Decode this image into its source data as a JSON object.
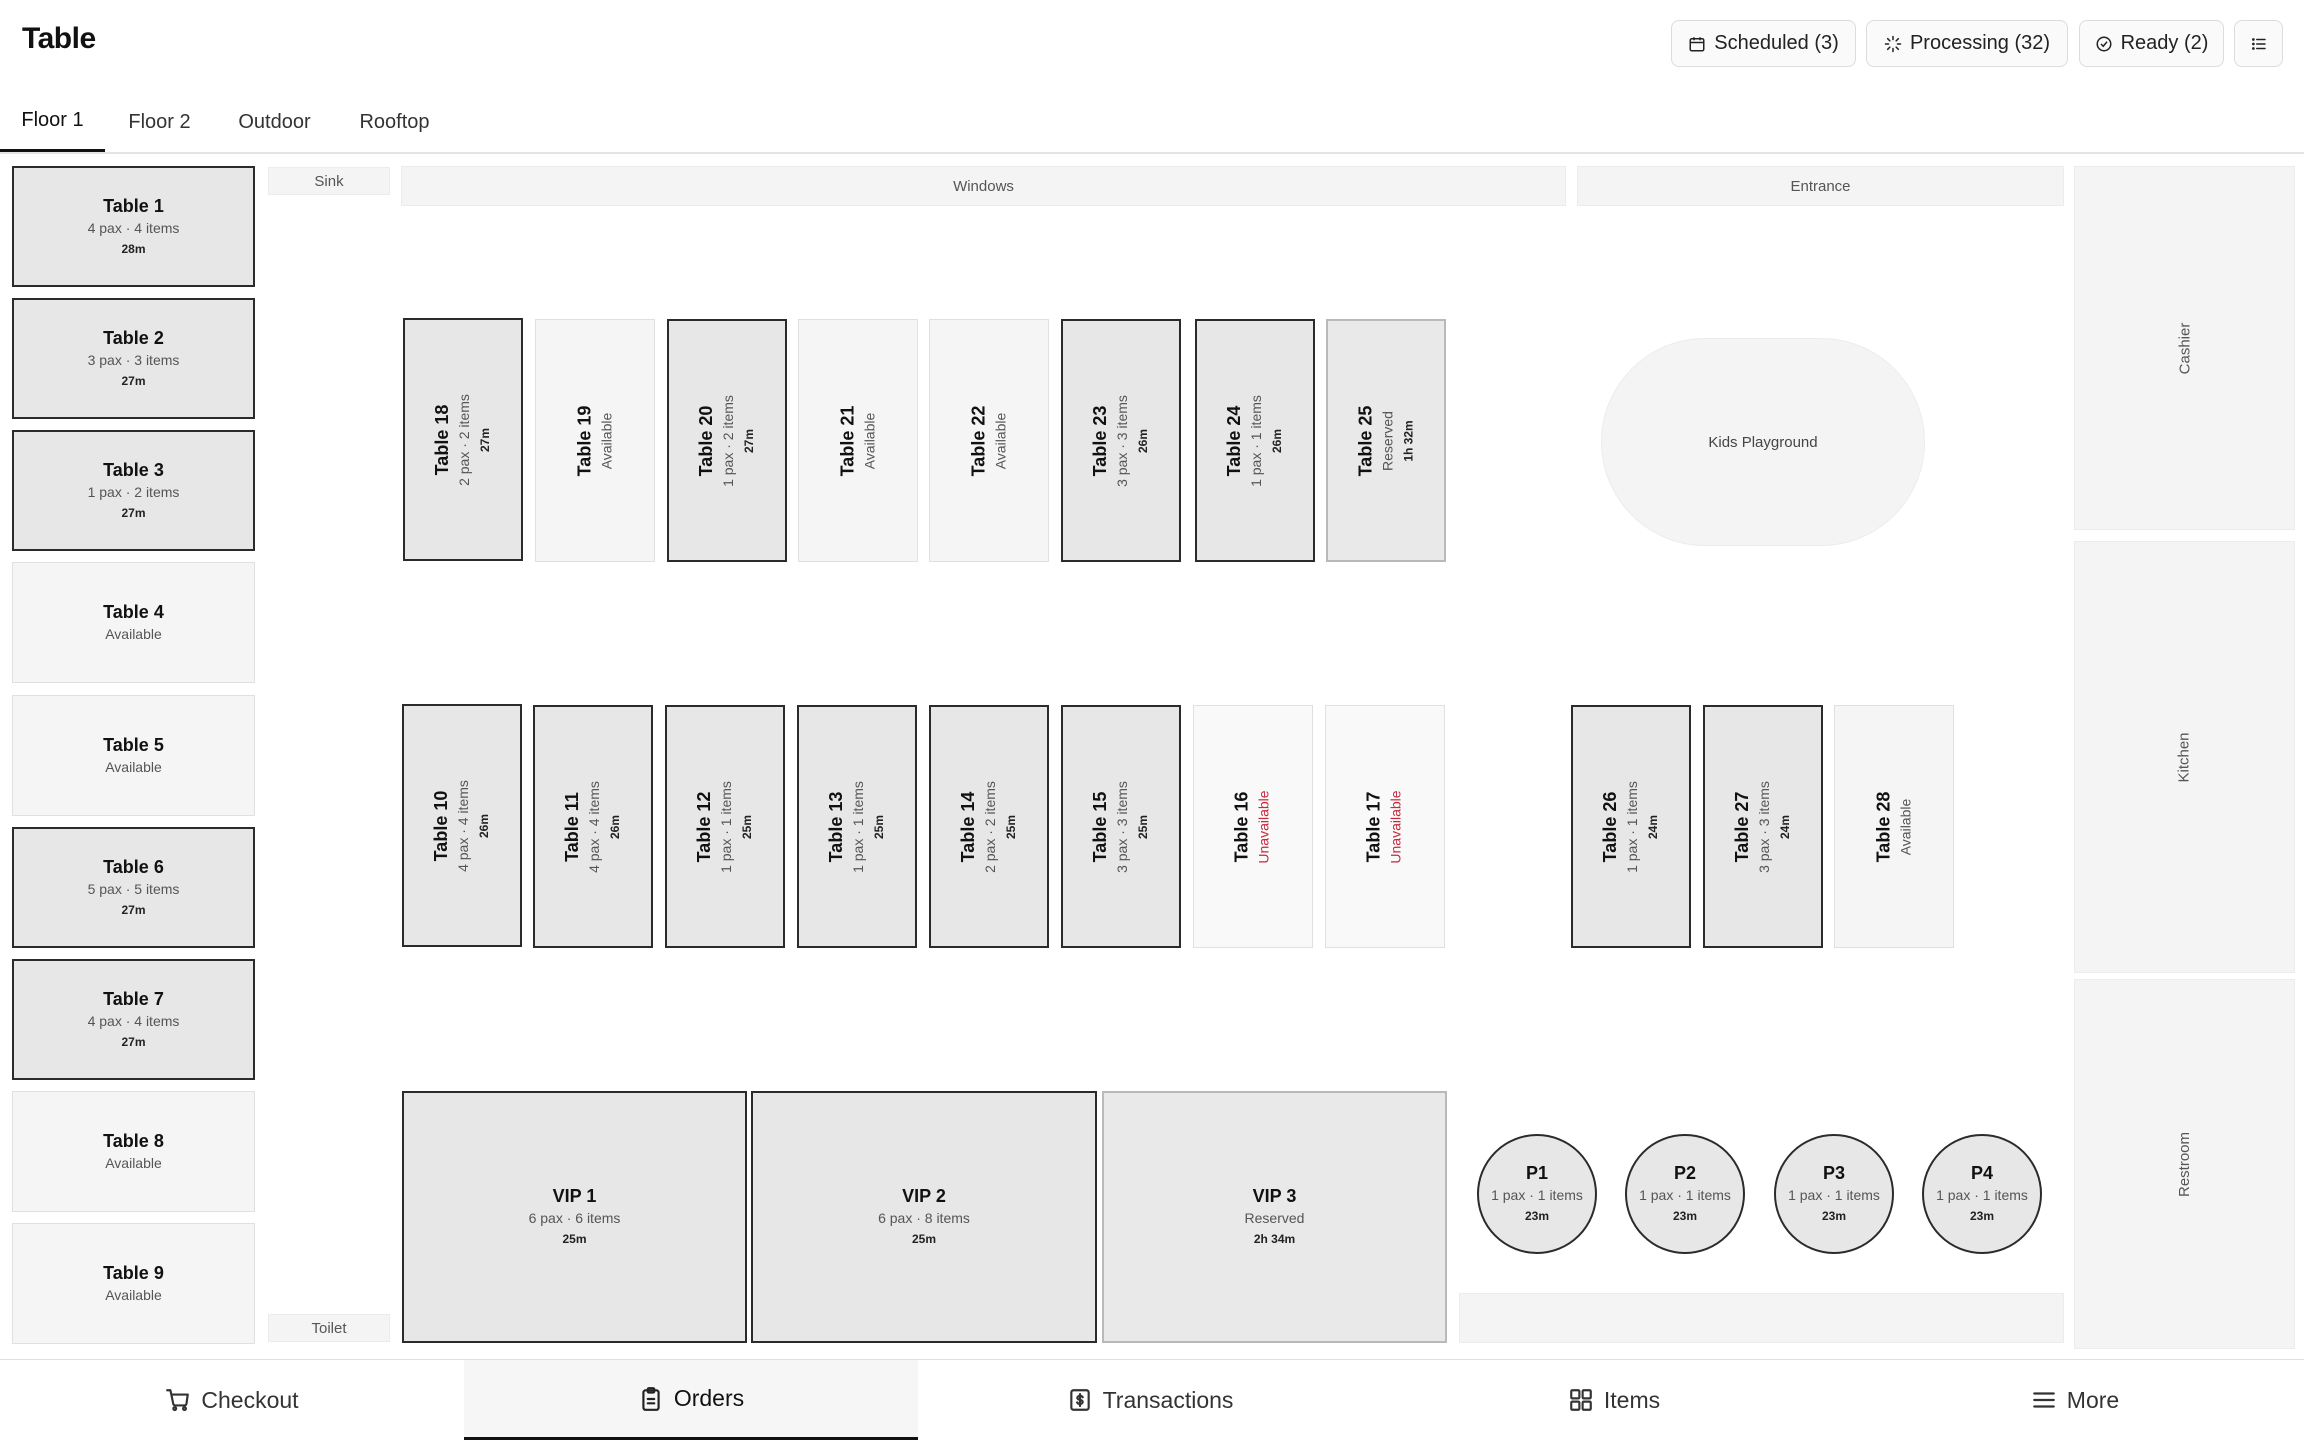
{
  "header": {
    "title": "Table",
    "scheduled_label": "Scheduled (3)",
    "processing_label": "Processing (32)",
    "ready_label": "Ready (2)"
  },
  "tabs": [
    "Floor 1",
    "Floor 2",
    "Outdoor",
    "Rooftop"
  ],
  "active_tab": "Floor 1",
  "zones": {
    "sink": "Sink",
    "toilet": "Toilet",
    "windows": "Windows",
    "entrance": "Entrance",
    "kids_playground": "Kids Playground",
    "cashier": "Cashier",
    "kitchen": "Kitchen",
    "restroom": "Restroom"
  },
  "tables": {
    "t1": {
      "name": "Table 1",
      "info": "4 pax · 4 items",
      "time": "28m"
    },
    "t2": {
      "name": "Table 2",
      "info": "3 pax · 3 items",
      "time": "27m"
    },
    "t3": {
      "name": "Table 3",
      "info": "1 pax · 2 items",
      "time": "27m"
    },
    "t4": {
      "name": "Table 4",
      "info": "Available"
    },
    "t5": {
      "name": "Table 5",
      "info": "Available"
    },
    "t6": {
      "name": "Table 6",
      "info": "5 pax · 5 items",
      "time": "27m"
    },
    "t7": {
      "name": "Table 7",
      "info": "4 pax · 4 items",
      "time": "27m"
    },
    "t8": {
      "name": "Table 8",
      "info": "Available"
    },
    "t9": {
      "name": "Table 9",
      "info": "Available"
    },
    "t10": {
      "name": "Table 10",
      "info": "4 pax · 4 items",
      "time": "26m"
    },
    "t11": {
      "name": "Table 11",
      "info": "4 pax · 4 items",
      "time": "26m"
    },
    "t12": {
      "name": "Table 12",
      "info": "1 pax · 1 items",
      "time": "25m"
    },
    "t13": {
      "name": "Table 13",
      "info": "1 pax · 1 items",
      "time": "25m"
    },
    "t14": {
      "name": "Table 14",
      "info": "2 pax · 2 items",
      "time": "25m"
    },
    "t15": {
      "name": "Table 15",
      "info": "3 pax · 3 items",
      "time": "25m"
    },
    "t16": {
      "name": "Table 16",
      "info": "Unavailable"
    },
    "t17": {
      "name": "Table 17",
      "info": "Unavailable"
    },
    "t18": {
      "name": "Table 18",
      "info": "2 pax · 2 items",
      "time": "27m"
    },
    "t19": {
      "name": "Table 19",
      "info": "Available"
    },
    "t20": {
      "name": "Table 20",
      "info": "1 pax · 2 items",
      "time": "27m"
    },
    "t21": {
      "name": "Table 21",
      "info": "Available"
    },
    "t22": {
      "name": "Table 22",
      "info": "Available"
    },
    "t23": {
      "name": "Table 23",
      "info": "3 pax · 3 items",
      "time": "26m"
    },
    "t24": {
      "name": "Table 24",
      "info": "1 pax · 1 items",
      "time": "26m"
    },
    "t25": {
      "name": "Table 25",
      "info": "Reserved",
      "time": "1h 32m"
    },
    "t26": {
      "name": "Table 26",
      "info": "1 pax · 1 items",
      "time": "24m"
    },
    "t27": {
      "name": "Table 27",
      "info": "3 pax · 3 items",
      "time": "24m"
    },
    "t28": {
      "name": "Table 28",
      "info": "Available"
    },
    "vip1": {
      "name": "VIP 1",
      "info": "6 pax · 6 items",
      "time": "25m"
    },
    "vip2": {
      "name": "VIP 2",
      "info": "6 pax · 8 items",
      "time": "25m"
    },
    "vip3": {
      "name": "VIP 3",
      "info": "Reserved",
      "time": "2h 34m"
    },
    "p1": {
      "name": "P1",
      "info": "1 pax · 1 items",
      "time": "23m"
    },
    "p2": {
      "name": "P2",
      "info": "1 pax · 1 items",
      "time": "23m"
    },
    "p3": {
      "name": "P3",
      "info": "1 pax · 1 items",
      "time": "23m"
    },
    "p4": {
      "name": "P4",
      "info": "1 pax · 1 items",
      "time": "23m"
    }
  },
  "bottom_nav": {
    "checkout": "Checkout",
    "orders": "Orders",
    "transactions": "Transactions",
    "items": "Items",
    "more": "More"
  },
  "colors": {
    "unavailable_text": "#c8283c",
    "occupied_fill": "#e7e7e8",
    "available_fill": "#f5f5f6"
  }
}
